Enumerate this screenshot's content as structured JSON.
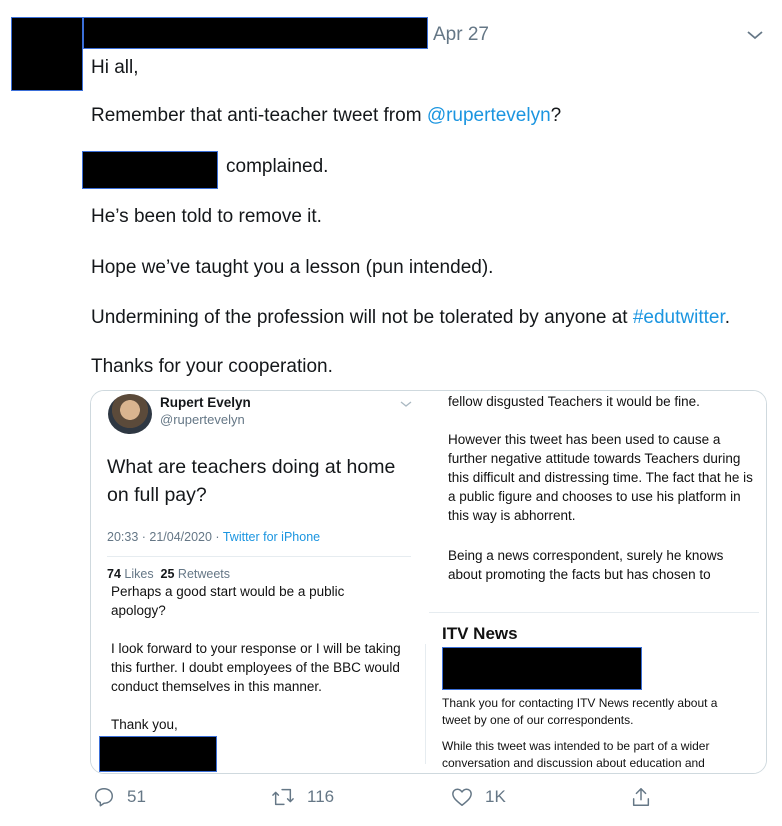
{
  "tweet": {
    "date": "Apr 27",
    "greeting": "Hi all,",
    "line1_pre": "Remember that anti-teacher tweet from ",
    "line1_mention": "@rupertevelyn",
    "line1_post": "?",
    "line2": "complained.",
    "line3": "He’s been told to remove it.",
    "line4": "Hope we’ve taught you a lesson (pun intended).",
    "line5_pre": "Undermining of the profession will not be tolerated by anyone at ",
    "line5_hashtag": "#edutwitter",
    "line5_post": ".",
    "line6": "Thanks for your cooperation."
  },
  "card": {
    "embedded": {
      "name": "Rupert Evelyn",
      "handle": "@rupertevelyn",
      "text": "What are teachers doing at home on full pay?",
      "time": "20:33 · 21/04/2020 · ",
      "client": "Twitter for iPhone",
      "likes_count": "74",
      "likes_label": "Likes",
      "retweets_count": "25",
      "retweets_label": "Retweets"
    },
    "complaint": {
      "p1": "Perhaps a good start would be a public apology?",
      "p2": "I look forward to your response or I will be taking this further. I doubt employees of the BBC would conduct themselves in this manner.",
      "p3": "Thank you,"
    },
    "right_top": {
      "p1": "fellow disgusted Teachers it would be fine.",
      "p2": "However this tweet has been used to cause a further negative attitude towards Teachers during this difficult and distressing time. The fact that he is a public figure and chooses to use his platform in this way is abhorrent.",
      "p3": "Being a news correspondent, surely he knows about promoting the facts but has chosen to"
    },
    "itv": {
      "title": "ITV News",
      "p1": "Thank you for contacting ITV News recently about a tweet by one of our correspondents.",
      "p2": "While this tweet was intended to be part of a wider conversation and discussion about education and"
    }
  },
  "actions": {
    "replies": "51",
    "retweets": "116",
    "likes": "1K"
  },
  "colors": {
    "link": "#1b95e0",
    "muted": "#657786",
    "redaction": "#000000"
  }
}
